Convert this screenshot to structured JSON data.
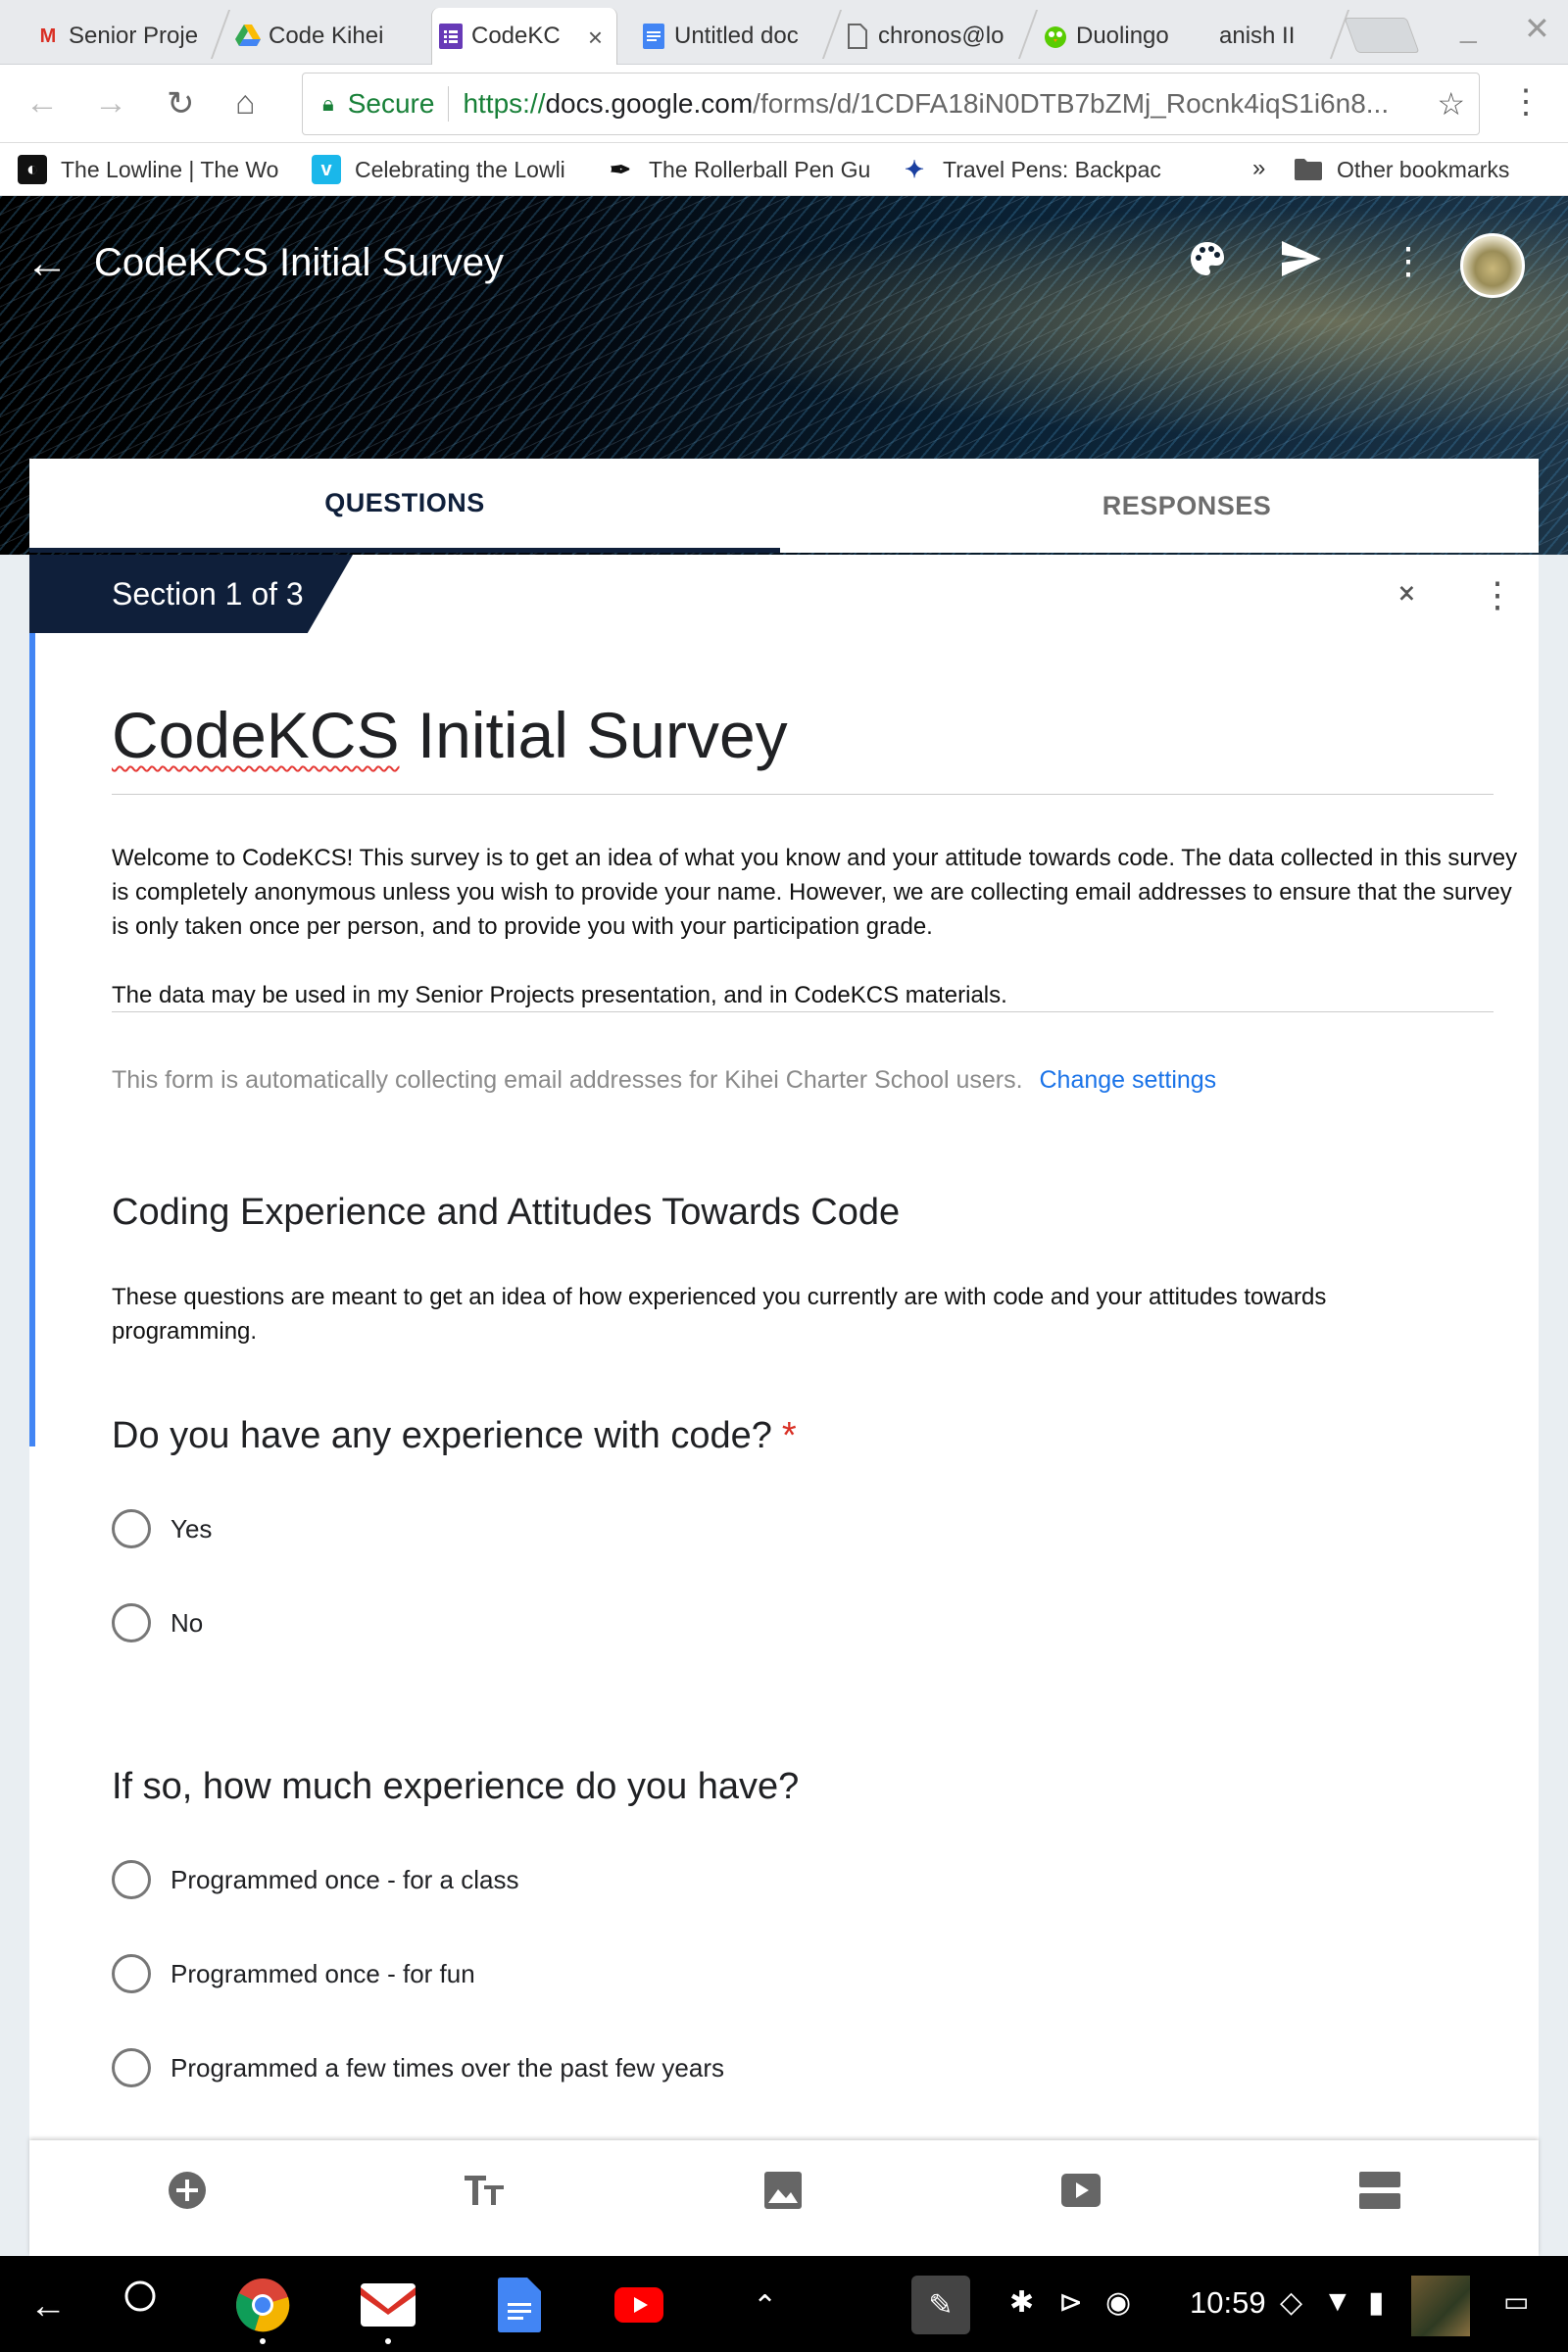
{
  "browser": {
    "tabs": [
      {
        "label": "Senior Proje",
        "icon": "gmail-icon"
      },
      {
        "label": "Code Kihei",
        "icon": "drive-icon"
      },
      {
        "label": "CodeKC",
        "icon": "forms-icon",
        "active": true
      },
      {
        "label": "Untitled doc",
        "icon": "docs-icon"
      },
      {
        "label": "chronos@lo",
        "icon": "file-icon"
      },
      {
        "label": "Duolingo",
        "icon": "duolingo-icon"
      },
      {
        "label": "anish II",
        "icon": "none"
      }
    ],
    "tab_close": "×",
    "window_minimize": "_",
    "window_close": "✕",
    "address": {
      "secure_label": "Secure",
      "scheme": "https://",
      "host": "docs.google.com",
      "path": "/forms/d/1CDFA18iN0DTB7bZMj_Rocnk4iqS1i6n8..."
    },
    "bookmarks": [
      {
        "label": "The Lowline | The Wo",
        "icon": "lowline-icon"
      },
      {
        "label": "Celebrating the Lowli",
        "icon": "vimeo-icon"
      },
      {
        "label": "The Rollerball Pen Gu",
        "icon": "pen-icon"
      },
      {
        "label": "Travel Pens: Backpac",
        "icon": "bird-icon"
      }
    ],
    "bookmarks_overflow": "»",
    "other_bookmarks": "Other bookmarks"
  },
  "header": {
    "title": "CodeKCS Initial Survey"
  },
  "tabs": {
    "questions": "QUESTIONS",
    "responses": "RESPONSES"
  },
  "section": {
    "badge": "Section 1 of 3"
  },
  "form": {
    "title_part1": "CodeKCS",
    "title_part2": " Initial Survey",
    "description_p1": "Welcome to CodeKCS! This survey is to get an idea of what you know and your attitude towards code. The data collected in this survey is completely anonymous unless you wish to provide your name. However, we are collecting email addresses to ensure that the survey is only taken once per person, and to provide you with your participation grade.",
    "description_p2": "The data may be used in my Senior Projects presentation, and in CodeKCS materials.",
    "email_note": "This form is automatically collecting email addresses for Kihei Charter School users.",
    "change_settings": "Change settings"
  },
  "section2": {
    "title": "Coding Experience and Attitudes Towards Code",
    "description": "These questions are meant to get an idea of how experienced you currently are with code and your attitudes towards programming."
  },
  "questions": [
    {
      "title": "Do you have any experience with code?",
      "required_mark": "*",
      "options": [
        "Yes",
        "No"
      ]
    },
    {
      "title": "If so, how much experience do you have?",
      "options": [
        "Programmed once - for a class",
        "Programmed once - for fun",
        "Programmed a few times over the past few years"
      ]
    }
  ],
  "shelf": {
    "time": "10:59"
  },
  "colors": {
    "form_accent": "#0f1f3a",
    "section_accent": "#4285f4",
    "link": "#1a73e8",
    "required": "#d93025",
    "secure_green": "#188038"
  }
}
